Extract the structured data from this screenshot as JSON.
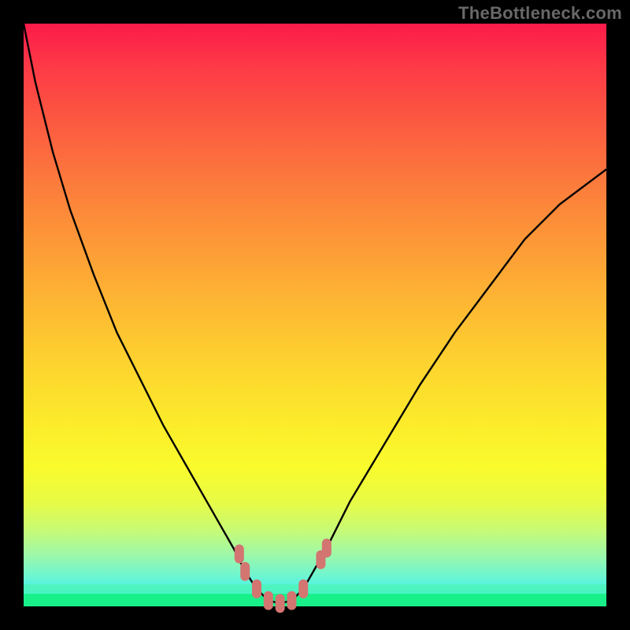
{
  "watermark": "TheBottleneck.com",
  "colors": {
    "background": "#000000",
    "curve": "#000000",
    "marker": "#d37571",
    "green_strip": "#18f18a"
  },
  "chart_data": {
    "type": "line",
    "title": "",
    "xlabel": "",
    "ylabel": "",
    "xlim": [
      0,
      100
    ],
    "ylim": [
      0,
      100
    ],
    "note": "Qualitative bottleneck curve; axes unlabeled so values are normalized positions read from the image.",
    "series": [
      {
        "name": "bottleneck-curve-left",
        "x": [
          0,
          2,
          5,
          8,
          12,
          16,
          20,
          24,
          28,
          32,
          36,
          38,
          40
        ],
        "y": [
          100,
          90,
          78,
          68,
          57,
          47,
          39,
          31,
          24,
          17,
          10,
          6,
          3
        ]
      },
      {
        "name": "bottleneck-curve-bottom",
        "x": [
          40,
          42,
          44,
          46,
          48
        ],
        "y": [
          3,
          1,
          0.5,
          1,
          3
        ]
      },
      {
        "name": "bottleneck-curve-right",
        "x": [
          48,
          52,
          56,
          62,
          68,
          74,
          80,
          86,
          92,
          100
        ],
        "y": [
          3,
          10,
          18,
          28,
          38,
          47,
          55,
          63,
          69,
          75
        ]
      }
    ],
    "markers": {
      "name": "highlighted-range",
      "points": [
        {
          "x": 37,
          "y": 9
        },
        {
          "x": 38,
          "y": 6
        },
        {
          "x": 40,
          "y": 3
        },
        {
          "x": 42,
          "y": 1
        },
        {
          "x": 44,
          "y": 0.5
        },
        {
          "x": 46,
          "y": 1
        },
        {
          "x": 48,
          "y": 3
        },
        {
          "x": 51,
          "y": 8
        },
        {
          "x": 52,
          "y": 10
        }
      ]
    }
  }
}
